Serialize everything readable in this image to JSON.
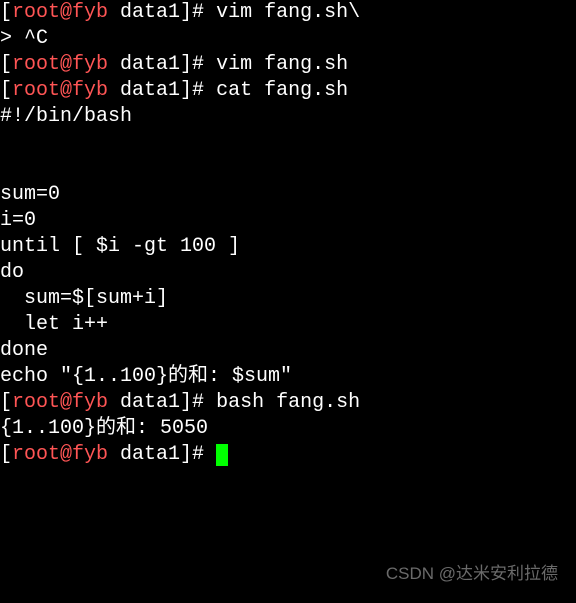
{
  "lines": {
    "l0_prompt_open": "[",
    "l0_userhost": "root@fyb",
    "l0_path": " data1",
    "l0_prompt_close": "]# ",
    "l0_cmd": "vim fang.sh\\",
    "l1": "> ^C",
    "l2_prompt_open": "[",
    "l2_userhost": "root@fyb",
    "l2_path": " data1",
    "l2_prompt_close": "]# ",
    "l2_cmd": "vim fang.sh",
    "l3_prompt_open": "[",
    "l3_userhost": "root@fyb",
    "l3_path": " data1",
    "l3_prompt_close": "]# ",
    "l3_cmd": "cat fang.sh",
    "l4": "#!/bin/bash",
    "l5": "",
    "l6": "",
    "l7": "sum=0",
    "l8": "i=0",
    "l9": "until [ $i -gt 100 ]",
    "l10": "do",
    "l11": "  sum=$[sum+i]",
    "l12": "  let i++",
    "l13": "done",
    "l14": "echo \"{1..100}的和: $sum\"",
    "l15_prompt_open": "[",
    "l15_userhost": "root@fyb",
    "l15_path": " data1",
    "l15_prompt_close": "]# ",
    "l15_cmd": "bash fang.sh",
    "l16": "{1..100}的和: 5050",
    "l17_prompt_open": "[",
    "l17_userhost": "root@fyb",
    "l17_path": " data1",
    "l17_prompt_close": "]# "
  },
  "watermark": "CSDN @达米安利拉德"
}
